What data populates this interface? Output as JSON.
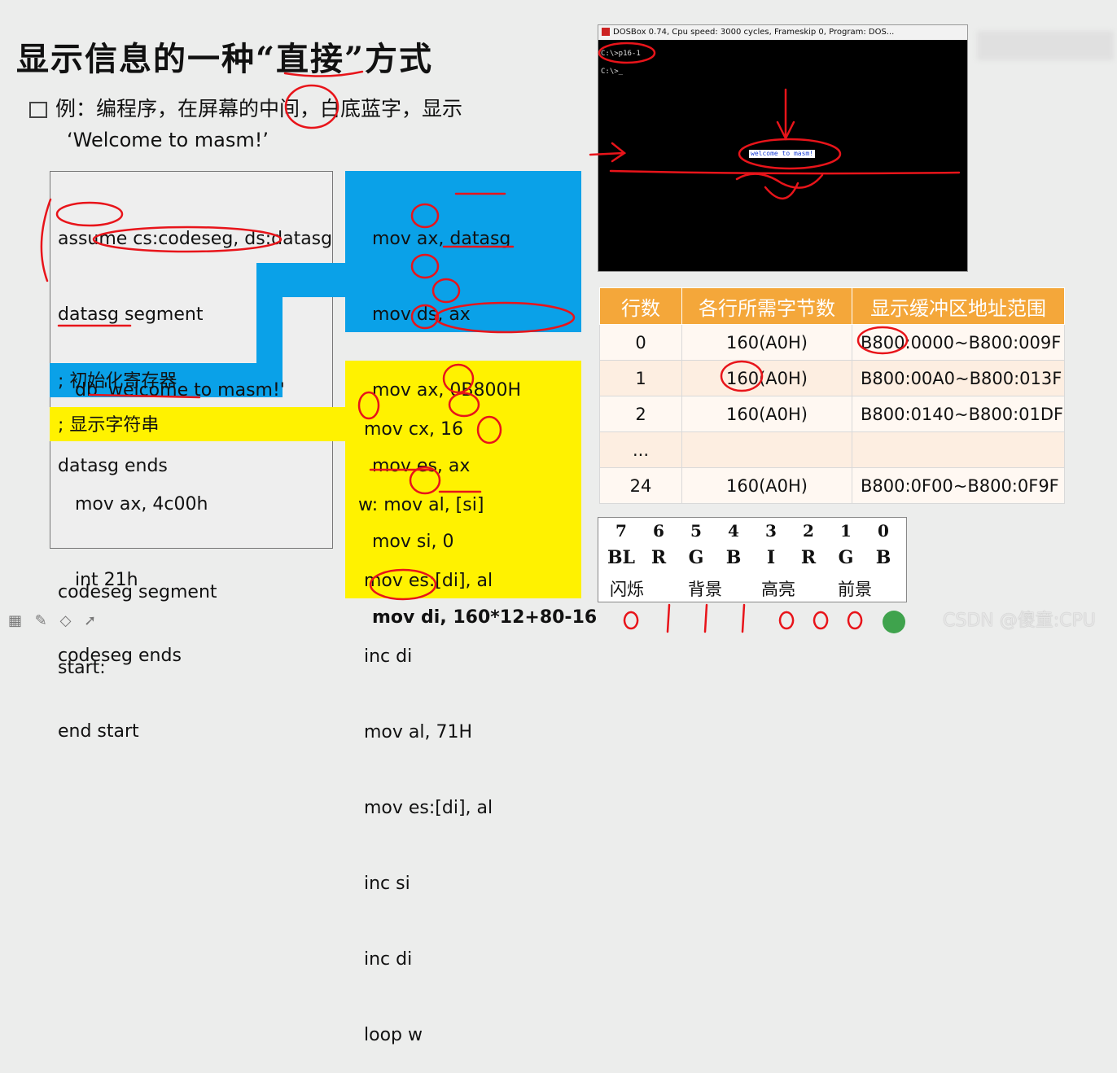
{
  "slide": {
    "title": "显示信息的一种“直接”方式",
    "example_line1": "例：编程序，在屏幕的中间，白底蓝字，显示",
    "example_line2": "‘Welcome to masm!’"
  },
  "code_left": {
    "lines": [
      "assume cs:codeseg, ds:datasg",
      "datasg segment",
      "   db 'welcome to masm!'",
      "datasg ends",
      "",
      "codeseg segment",
      "start:"
    ],
    "init_comment": "; 初始化寄存器",
    "display_comment": "; 显示字符串",
    "tail_lines": [
      "   mov ax, 4c00h",
      "   int 21h",
      "codeseg ends",
      "end start"
    ]
  },
  "code_blue": [
    "mov ax, datasg",
    "mov ds, ax",
    "mov ax, 0B800H",
    "mov es, ax",
    "mov si, 0",
    "mov di, 160*12+80-16"
  ],
  "code_yellow": [
    " mov cx, 16",
    "w: mov al, [si]",
    " mov es:[di], al",
    " inc di",
    " mov al, 71H",
    " mov es:[di], al",
    " inc si",
    " inc di",
    " loop w"
  ],
  "dosbox": {
    "title": "DOSBox 0.74, Cpu speed:     3000 cycles, Frameskip  0, Program:  DOS...",
    "line1": "C:\\>p16-1",
    "line2": "C:\\>_",
    "output": "welcome to masm!"
  },
  "memory_table": {
    "headers": [
      "行数",
      "各行所需字节数",
      "显示缓冲区地址范围"
    ],
    "rows": [
      [
        "0",
        "160(A0H)",
        "B800:0000~B800:009F"
      ],
      [
        "1",
        "160(A0H)",
        "B800:00A0~B800:013F"
      ],
      [
        "2",
        "160(A0H)",
        "B800:0140~B800:01DF"
      ],
      [
        "...",
        "",
        ""
      ],
      [
        "24",
        "160(A0H)",
        "B800:0F00~B800:0F9F"
      ]
    ]
  },
  "attribute_byte": {
    "bits": [
      "7",
      "6",
      "5",
      "4",
      "3",
      "2",
      "1",
      "0"
    ],
    "names": [
      "BL",
      "R",
      "G",
      "B",
      "I",
      "R",
      "G",
      "B"
    ],
    "groups": [
      "闪烁",
      "背景",
      "高亮",
      "前景"
    ]
  },
  "watermark": "CSDN @傻童:CPU",
  "colors": {
    "blue_panel": "#0aa1e8",
    "yellow_panel": "#fff200",
    "table_header": "#f4a73a",
    "ink": "#e8141a"
  }
}
